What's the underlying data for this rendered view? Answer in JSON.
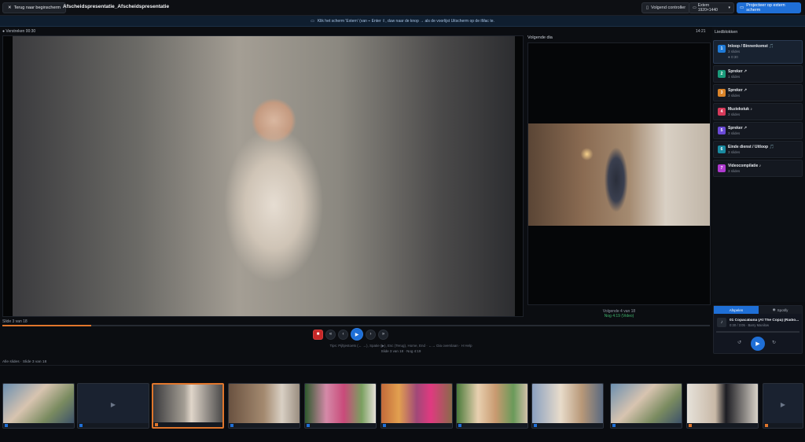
{
  "topbar": {
    "back_label": "Terug naar beginscherm",
    "project_title": "Afscheidspresentatie_Afscheidspresentatie",
    "verify_label": "Volgend controller",
    "screen_label": "Extern 1920×1440",
    "project_label": "Projecteer op extern scherm"
  },
  "banner": {
    "text": "Klik het scherm 'Extern' (van ⌁ Enter ⇧, duw naar de knop → als de voorlijst Uitscherm op de iMac te."
  },
  "current": {
    "label": "● Verstreken 00:30",
    "time": "14:21"
  },
  "next": {
    "label": "Volgende dia",
    "meta1": "Volgende 4 van 18",
    "meta2": "Nog 4:19 (Video)"
  },
  "progress": {
    "slide_count": "Slide 3 van 18",
    "fraction": 0.125
  },
  "controls": {
    "stop": "■",
    "first": "«",
    "prev": "‹",
    "play": "▶",
    "next": "›",
    "last": "»",
    "shortcuts": "Tips: Pijltjestoets (← →), Spatie (▶), Esc (Terug), Home, End · ←→ Dia overslaan · H Help",
    "keyhint": "Slide 3 van 18 · Nog 4:19"
  },
  "sidebar": {
    "title": "Liedblokken",
    "songs": [
      {
        "num": "1",
        "color": "#1f7ad6",
        "title": "Inloop / Binnenkomst 🎵",
        "sub": "3 slides",
        "sub2": "● 0:30",
        "active": true
      },
      {
        "num": "2",
        "color": "#1a9a7a",
        "title": "Spreker ↗",
        "sub": "1 slides"
      },
      {
        "num": "3",
        "color": "#d9842a",
        "title": "Spreker ↗",
        "sub": "3 slides"
      },
      {
        "num": "4",
        "color": "#d63a5a",
        "title": "Muziekstuk ♪",
        "sub": "3 slides"
      },
      {
        "num": "5",
        "color": "#6a4ad6",
        "title": "Spreker ↗",
        "sub": "3 slides"
      },
      {
        "num": "6",
        "color": "#1a8aa0",
        "title": "Einde dienst / Uitloop 🎵",
        "sub": "3 slides"
      },
      {
        "num": "7",
        "color": "#b03ad0",
        "title": "Videocompilatie ♪",
        "sub": "3 slides"
      }
    ]
  },
  "player": {
    "tab_playing": "Afspelen",
    "tab_spotify": "Spotify",
    "track_title": "01 Copacabana (At The Copa) (Radio...",
    "track_sub": "0:30 / 3:05 · Barry Manilow",
    "prev": "↺",
    "play": "▶",
    "next": "↻"
  },
  "filmstrip": {
    "label": "Alle slides · Slide 3 van 18",
    "thumbs": [
      {
        "kind": "photo",
        "cls": "g1",
        "badge": "blue"
      },
      {
        "kind": "video",
        "cls": "",
        "badge": "blue"
      },
      {
        "kind": "photo",
        "cls": "g2",
        "badge": "orange",
        "active": true
      },
      {
        "kind": "photo",
        "cls": "g3",
        "badge": "blue"
      },
      {
        "kind": "photo",
        "cls": "g4",
        "badge": "blue"
      },
      {
        "kind": "photo",
        "cls": "g5",
        "badge": "blue"
      },
      {
        "kind": "photo",
        "cls": "g6",
        "badge": "blue"
      },
      {
        "kind": "photo",
        "cls": "g8",
        "badge": "blue"
      },
      {
        "kind": "photo",
        "cls": "g1",
        "badge": "blue"
      },
      {
        "kind": "photo",
        "cls": "g9",
        "badge": "orange"
      },
      {
        "kind": "video",
        "cls": "",
        "badge": "orange"
      }
    ]
  }
}
